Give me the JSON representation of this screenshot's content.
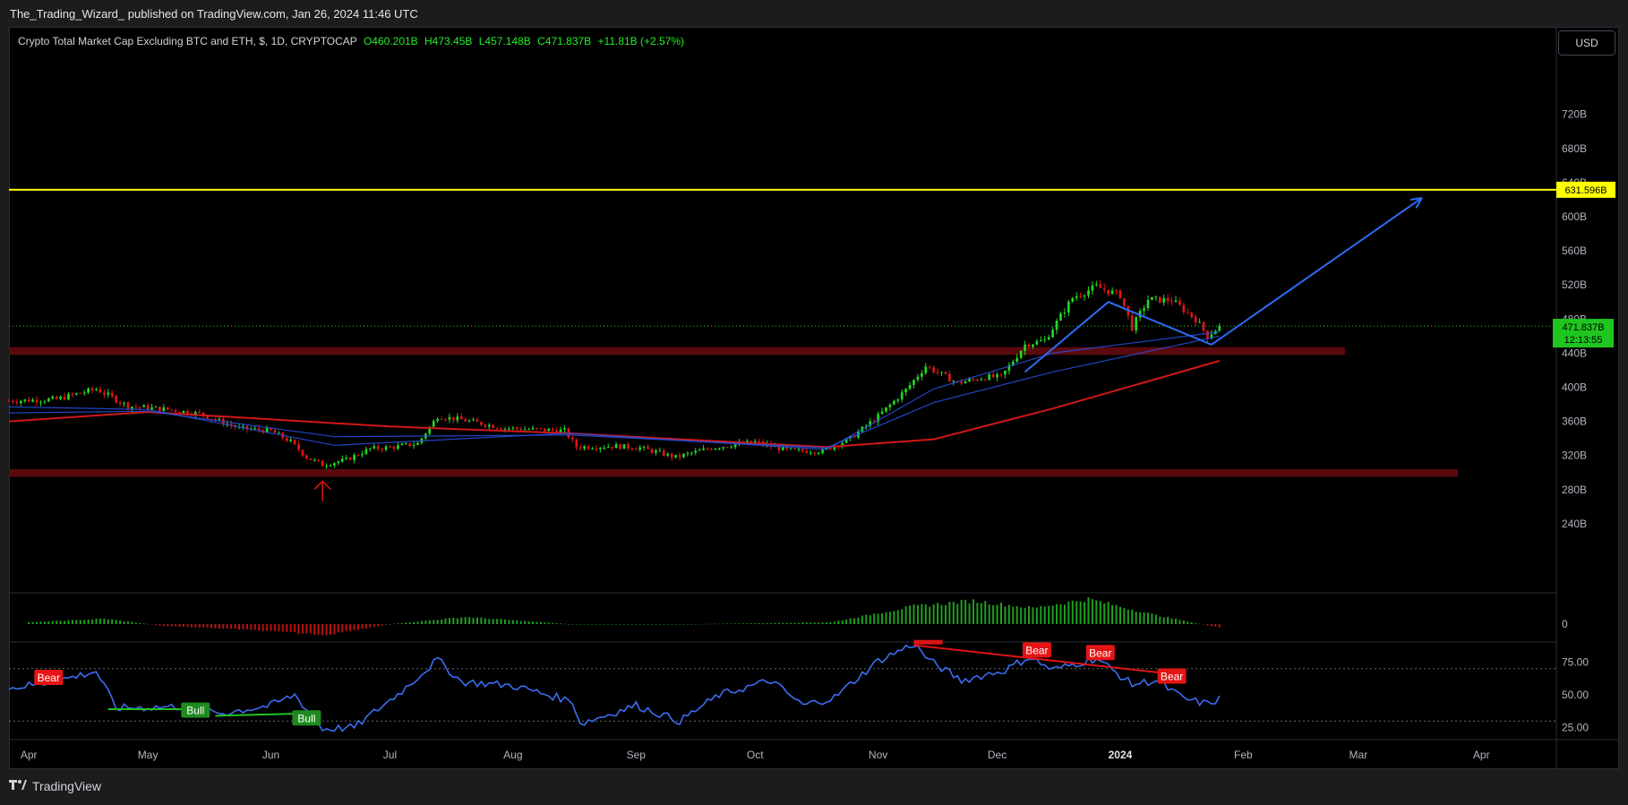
{
  "header": {
    "publisher_text": "The_Trading_Wizard_ published on TradingView.com, Jan 26, 2024 11:46 UTC"
  },
  "legend": {
    "symbol": "Crypto Total Market Cap Excluding BTC and ETH, $, 1D, CRYPTOCAP",
    "open": "O460.201B",
    "high": "H473.45B",
    "low": "L457.148B",
    "close": "C471.837B",
    "change": "+11.81B (+2.57%)"
  },
  "currency_button": "USD",
  "footer": {
    "brand": "TradingView",
    "brand_icon": "tradingview-logo-icon"
  },
  "colors": {
    "background": "#000000",
    "up": "#22d822",
    "down": "#e01414",
    "ema_red": "#d01818",
    "ema_blue": "#2850e0",
    "resistance": "#ffff00",
    "zone": "#5a0a0e",
    "drawing": "#2e6cf2",
    "rsi": "#3d6cf0"
  },
  "chart_data": [
    {
      "type": "candlestick",
      "title": "Crypto Total Market Cap Excluding BTC and ETH, $, 1D, CRYPTOCAP",
      "scale": "linear",
      "grid": false,
      "ylim": [
        190,
        790
      ],
      "y_ticks": [
        "720B",
        "680B",
        "640B",
        "600B",
        "560B",
        "520B",
        "480B",
        "440B",
        "400B",
        "360B",
        "320B",
        "280B",
        "240B"
      ],
      "x_ticks": [
        "Apr",
        "May",
        "Jun",
        "Jul",
        "Aug",
        "Sep",
        "Oct",
        "Nov",
        "Dec",
        "2024",
        "Feb",
        "Mar",
        "Apr"
      ],
      "x_range": [
        "2023-03-27",
        "2024-04-05"
      ],
      "close_series": [
        [
          "2023-03-27",
          384
        ],
        [
          "2023-04-08",
          386
        ],
        [
          "2023-04-18",
          398
        ],
        [
          "2023-04-22",
          388
        ],
        [
          "2023-04-26",
          378
        ],
        [
          "2023-05-06",
          374
        ],
        [
          "2023-05-14",
          369
        ],
        [
          "2023-05-24",
          352
        ],
        [
          "2023-06-01",
          349
        ],
        [
          "2023-06-06",
          336
        ],
        [
          "2023-06-10",
          318
        ],
        [
          "2023-06-14",
          309
        ],
        [
          "2023-06-20",
          315
        ],
        [
          "2023-06-26",
          328
        ],
        [
          "2023-07-02",
          330
        ],
        [
          "2023-07-08",
          334
        ],
        [
          "2023-07-13",
          366
        ],
        [
          "2023-07-19",
          362
        ],
        [
          "2023-07-30",
          352
        ],
        [
          "2023-08-14",
          349
        ],
        [
          "2023-08-17",
          330
        ],
        [
          "2023-08-27",
          331
        ],
        [
          "2023-09-02",
          329
        ],
        [
          "2023-09-11",
          318
        ],
        [
          "2023-09-20",
          329
        ],
        [
          "2023-10-01",
          336
        ],
        [
          "2023-10-09",
          326
        ],
        [
          "2023-10-18",
          325
        ],
        [
          "2023-10-25",
          340
        ],
        [
          "2023-11-01",
          366
        ],
        [
          "2023-11-08",
          397
        ],
        [
          "2023-11-13",
          425
        ],
        [
          "2023-11-21",
          405
        ],
        [
          "2023-11-28",
          412
        ],
        [
          "2023-12-02",
          412
        ],
        [
          "2023-12-08",
          450
        ],
        [
          "2023-12-13",
          455
        ],
        [
          "2023-12-20",
          505
        ],
        [
          "2023-12-26",
          518
        ],
        [
          "2024-01-01",
          508
        ],
        [
          "2024-01-04",
          470
        ],
        [
          "2024-01-08",
          503
        ],
        [
          "2024-01-14",
          502
        ],
        [
          "2024-01-20",
          480
        ],
        [
          "2024-01-23",
          460
        ],
        [
          "2024-01-26",
          471.837
        ]
      ],
      "moving_averages": [
        {
          "color": "red",
          "points": [
            [
              "2023-03-27",
              360
            ],
            [
              "2023-05-01",
              371
            ],
            [
              "2023-07-01",
              354
            ],
            [
              "2023-08-15",
              346
            ],
            [
              "2023-10-19",
              330
            ],
            [
              "2023-11-15",
              339
            ],
            [
              "2023-12-15",
              375
            ],
            [
              "2024-01-26",
              431
            ]
          ]
        },
        {
          "color": "blue",
          "points": [
            [
              "2023-03-27",
              370
            ],
            [
              "2023-05-01",
              372
            ],
            [
              "2023-06-17",
              342
            ],
            [
              "2023-08-15",
              344
            ],
            [
              "2023-10-19",
              329
            ],
            [
              "2023-11-15",
              382
            ],
            [
              "2023-12-15",
              418
            ],
            [
              "2024-01-26",
              460
            ]
          ]
        },
        {
          "color": "blue",
          "points": [
            [
              "2023-03-27",
              377
            ],
            [
              "2023-05-01",
              374
            ],
            [
              "2023-06-17",
              332
            ],
            [
              "2023-08-15",
              346
            ],
            [
              "2023-10-19",
              327
            ],
            [
              "2023-11-15",
              398
            ],
            [
              "2023-12-15",
              440
            ],
            [
              "2024-01-26",
              465
            ]
          ]
        }
      ],
      "horizontal_lines": [
        {
          "value": 631.596,
          "label": "631.596B",
          "color": "yellow"
        }
      ],
      "zones": [
        {
          "from": 438,
          "to": 447
        },
        {
          "from": 295,
          "to": 304
        }
      ],
      "drawings": [
        {
          "type": "path",
          "points": [
            [
              "2023-12-08",
              418
            ],
            [
              "2023-12-29",
              500
            ],
            [
              "2024-01-24",
              450
            ]
          ]
        },
        {
          "type": "arrow",
          "from": [
            "2024-01-24",
            450
          ],
          "to": [
            "2024-03-17",
            622
          ]
        },
        {
          "type": "arrow-up",
          "date": "2023-06-14",
          "value": 294
        }
      ],
      "last_price": {
        "label": "471.837B",
        "countdown": "12:13:55"
      }
    },
    {
      "type": "histogram",
      "title": "",
      "zero_label": "0",
      "values": [
        [
          "2023-04-01",
          1
        ],
        [
          "2023-04-20",
          3
        ],
        [
          "2023-05-05",
          -1
        ],
        [
          "2023-05-25",
          -3
        ],
        [
          "2023-06-15",
          -6
        ],
        [
          "2023-07-01",
          0
        ],
        [
          "2023-07-20",
          4
        ],
        [
          "2023-08-15",
          0
        ],
        [
          "2023-09-15",
          0
        ],
        [
          "2023-10-20",
          1
        ],
        [
          "2023-11-10",
          10
        ],
        [
          "2023-11-25",
          13
        ],
        [
          "2023-12-10",
          9
        ],
        [
          "2023-12-24",
          14
        ],
        [
          "2024-01-10",
          5
        ],
        [
          "2024-01-26",
          -2
        ]
      ]
    },
    {
      "type": "line",
      "title": "",
      "ylim": [
        15,
        90
      ],
      "y_ticks": [
        "75.00",
        "50.00",
        "25.00"
      ],
      "levels": [
        70,
        30
      ],
      "series": [
        {
          "values": [
            [
              "2023-03-27",
              55
            ],
            [
              "2023-04-07",
              60
            ],
            [
              "2023-04-18",
              68
            ],
            [
              "2023-04-23",
              40
            ],
            [
              "2023-05-10",
              41
            ],
            [
              "2023-05-20",
              36
            ],
            [
              "2023-06-01",
              42
            ],
            [
              "2023-06-07",
              50
            ],
            [
              "2023-06-14",
              24
            ],
            [
              "2023-06-22",
              25
            ],
            [
              "2023-07-04",
              53
            ],
            [
              "2023-07-13",
              77
            ],
            [
              "2023-07-19",
              60
            ],
            [
              "2023-08-01",
              57
            ],
            [
              "2023-08-16",
              45
            ],
            [
              "2023-08-18",
              28
            ],
            [
              "2023-09-01",
              42
            ],
            [
              "2023-09-12",
              30
            ],
            [
              "2023-09-22",
              50
            ],
            [
              "2023-10-05",
              61
            ],
            [
              "2023-10-13",
              42
            ],
            [
              "2023-10-21",
              48
            ],
            [
              "2023-11-01",
              76
            ],
            [
              "2023-11-10",
              89
            ],
            [
              "2023-11-14",
              76
            ],
            [
              "2023-11-22",
              61
            ],
            [
              "2023-12-03",
              69
            ],
            [
              "2023-12-09",
              79
            ],
            [
              "2023-12-15",
              69
            ],
            [
              "2023-12-26",
              78
            ],
            [
              "2024-01-04",
              58
            ],
            [
              "2024-01-10",
              61
            ],
            [
              "2024-01-17",
              47
            ],
            [
              "2024-01-23",
              43
            ],
            [
              "2024-01-26",
              47
            ]
          ]
        }
      ],
      "divergence_labels": [
        {
          "text": "Bear",
          "date": "2023-04-06",
          "value": 63
        },
        {
          "text": "Bull",
          "date": "2023-05-13",
          "value": 38
        },
        {
          "text": "Bull",
          "date": "2023-06-10",
          "value": 32
        },
        {
          "text": "Bear",
          "date": "2023-12-11",
          "value": 84
        },
        {
          "text": "Bear",
          "date": "2023-12-27",
          "value": 82
        },
        {
          "text": "Bear",
          "date": "2024-01-14",
          "value": 64
        }
      ]
    }
  ]
}
